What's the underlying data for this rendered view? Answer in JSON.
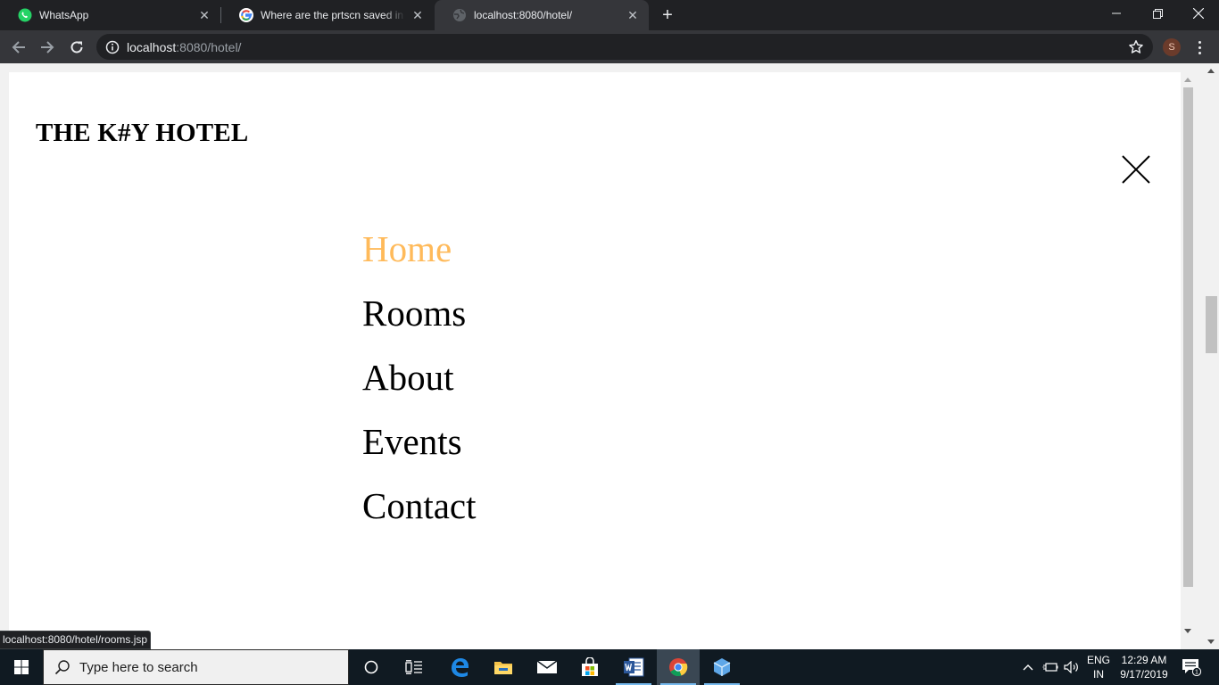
{
  "browser": {
    "tabs": [
      {
        "title": "WhatsApp",
        "icon": "whatsapp-icon"
      },
      {
        "title": "Where are the prtscn saved in W",
        "icon": "google-icon"
      },
      {
        "title": "localhost:8080/hotel/",
        "icon": "globe-icon",
        "active": true
      }
    ],
    "address": {
      "host": "localhost",
      "path": ":8080/hotel/"
    },
    "profile_initial": "S",
    "status_url": "localhost:8080/hotel/rooms.jsp"
  },
  "page": {
    "logo": "THE K#Y HOTEL",
    "menu": [
      {
        "label": "Home",
        "active": true
      },
      {
        "label": "Rooms"
      },
      {
        "label": "About"
      },
      {
        "label": "Events"
      },
      {
        "label": "Contact"
      }
    ],
    "accent_color": "#ffba5a"
  },
  "taskbar": {
    "search_placeholder": "Type here to search",
    "language": "ENG",
    "region": "IN",
    "time": "12:29 AM",
    "date": "9/17/2019",
    "notification_count": "1"
  }
}
